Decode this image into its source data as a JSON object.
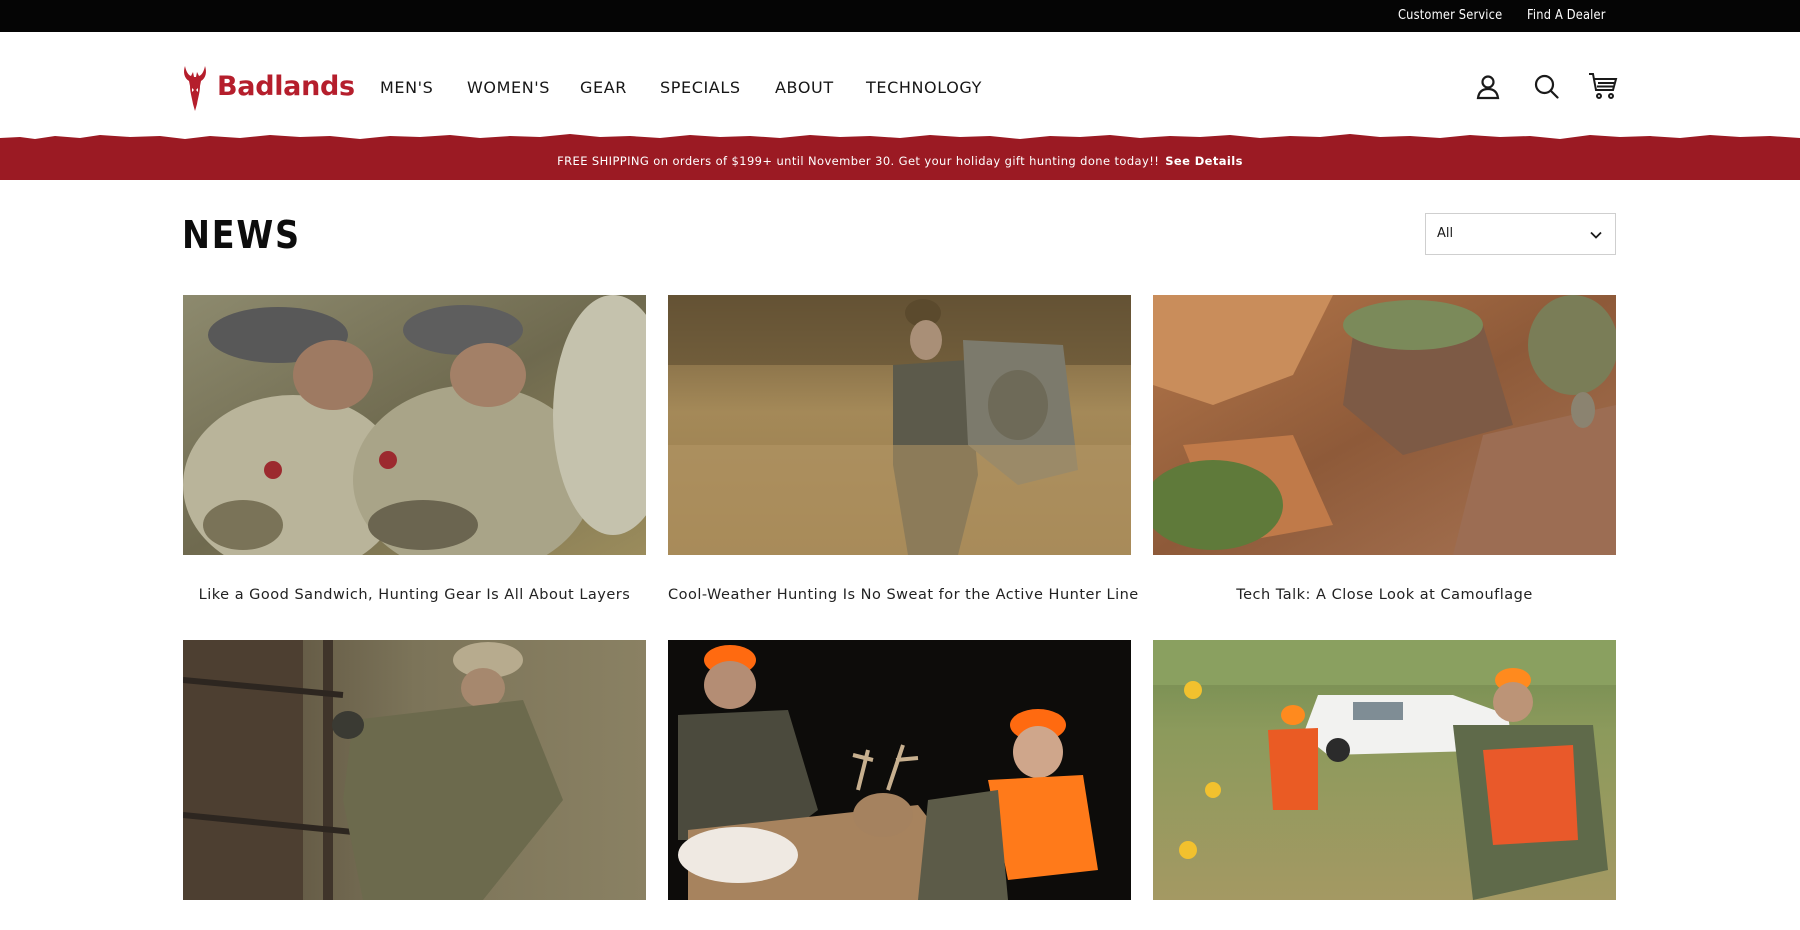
{
  "colors": {
    "brand_red": "#b51e2c",
    "promo_background": "#9b1a23",
    "utility_background": "#050505"
  },
  "utility_bar": {
    "links": [
      "Customer Service",
      "Find A Dealer"
    ]
  },
  "header": {
    "logo_text": "Badlands",
    "logo_icon": "skull-antler-icon",
    "nav": [
      "MEN'S",
      "WOMEN'S",
      "GEAR",
      "SPECIALS",
      "ABOUT",
      "TECHNOLOGY"
    ],
    "icons": [
      "account-icon",
      "search-icon",
      "cart-icon"
    ]
  },
  "promo": {
    "message": "FREE SHIPPING on orders of $199+ until November 30. Get your holiday gift hunting done today!!",
    "link_label": "See Details"
  },
  "page": {
    "title": "NEWS",
    "filter": {
      "selected": "All"
    }
  },
  "articles": [
    {
      "title": "Like a Good Sandwich, Hunting Gear Is All About Layers"
    },
    {
      "title": "Cool-Weather Hunting Is No Sweat for the Active Hunter Line"
    },
    {
      "title": "Tech Talk: A Close Look at Camouflage"
    },
    {
      "title": ""
    },
    {
      "title": ""
    },
    {
      "title": ""
    }
  ]
}
